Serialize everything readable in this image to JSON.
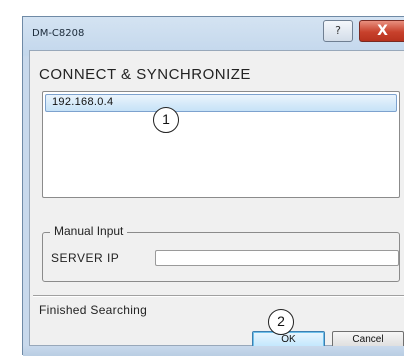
{
  "window": {
    "title": "DM-C8208",
    "help_symbol": "?",
    "close_symbol": "X"
  },
  "dialog": {
    "heading": "CONNECT & SYNCHRONIZE",
    "server_list": [
      {
        "address": "192.168.0.4",
        "selected": true
      }
    ],
    "manual_input": {
      "legend": "Manual Input",
      "server_ip_label": "SERVER IP",
      "server_ip_value": ""
    },
    "status": "Finished Searching",
    "buttons": {
      "ok": "OK",
      "cancel": "Cancel"
    }
  },
  "annotations": {
    "callout_1": "1",
    "callout_2": "2"
  },
  "colors": {
    "close_button": "#c8412c",
    "selection": "#c6e2f7",
    "default_button_border": "#3c7fb1"
  },
  "icons": {
    "help": "help-icon",
    "close": "close-icon"
  }
}
